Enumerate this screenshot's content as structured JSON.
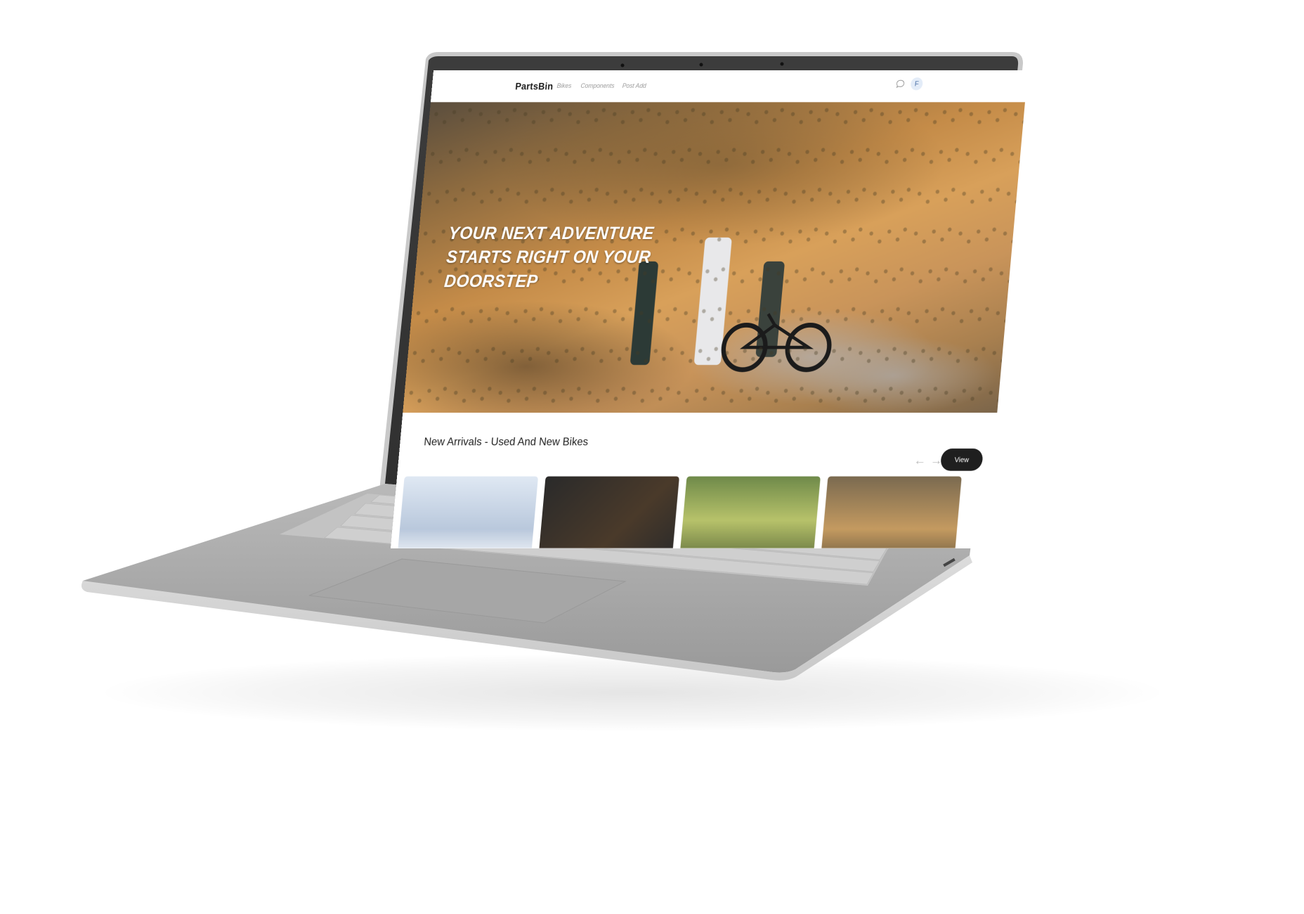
{
  "nav": {
    "brand": "PartsBin",
    "links": [
      "Bikes",
      "Components",
      "Post Add"
    ],
    "avatar_initial": "F"
  },
  "hero": {
    "lines": [
      "YOUR NEXT ADVENTURE",
      "STARTS RIGHT ON YOUR",
      "DOORSTEP"
    ]
  },
  "arrivals": {
    "title": "New Arrivals - Used And New Bikes",
    "view_label": "View",
    "prev_arrow": "←",
    "next_arrow": "→"
  },
  "colors": {
    "brand_dark": "#1f1f1f",
    "accent_avatar_bg": "#e3ecf8"
  }
}
